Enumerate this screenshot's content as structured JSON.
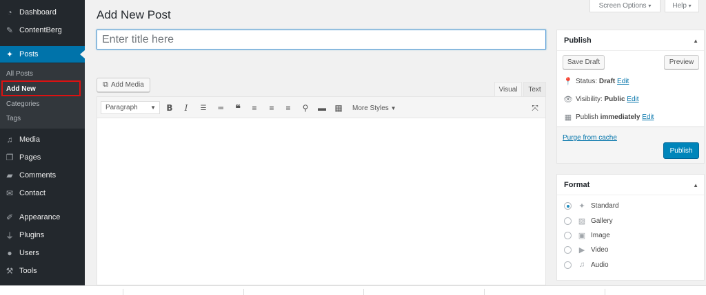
{
  "sidebar": {
    "items": [
      {
        "label": "Dashboard",
        "icon": "dashboard-icon"
      },
      {
        "label": "ContentBerg",
        "icon": "brush-icon"
      },
      {
        "label": "Posts",
        "icon": "pin-icon"
      },
      {
        "label": "Media",
        "icon": "media-icon"
      },
      {
        "label": "Pages",
        "icon": "pages-icon"
      },
      {
        "label": "Comments",
        "icon": "comment-icon"
      },
      {
        "label": "Contact",
        "icon": "mail-icon"
      },
      {
        "label": "Appearance",
        "icon": "paintbrush-icon"
      },
      {
        "label": "Plugins",
        "icon": "plug-icon"
      },
      {
        "label": "Users",
        "icon": "user-icon"
      },
      {
        "label": "Tools",
        "icon": "wrench-icon"
      }
    ],
    "submenu": [
      "All Posts",
      "Add New",
      "Categories",
      "Tags"
    ],
    "accent": "#0073aa",
    "highlight_color": "#dd1111"
  },
  "topbar": {
    "screen_options": "Screen Options",
    "help": "Help"
  },
  "page": {
    "title": "Add New Post",
    "title_placeholder": "Enter title here"
  },
  "editor": {
    "add_media": "Add Media",
    "tab_visual": "Visual",
    "tab_text": "Text",
    "format_select": "Paragraph",
    "more_styles": "More Styles"
  },
  "publish": {
    "heading": "Publish",
    "save_draft": "Save Draft",
    "preview": "Preview",
    "status_label": "Status:",
    "status_value": "Draft",
    "visibility_label": "Visibility:",
    "visibility_value": "Public",
    "publish_label": "Publish",
    "publish_value": "immediately",
    "edit": "Edit",
    "purge": "Purge from cache",
    "publish_button": "Publish",
    "button_color": "#0085ba"
  },
  "format": {
    "heading": "Format",
    "options": [
      "Standard",
      "Gallery",
      "Image",
      "Video",
      "Audio"
    ],
    "selected": "Standard"
  }
}
